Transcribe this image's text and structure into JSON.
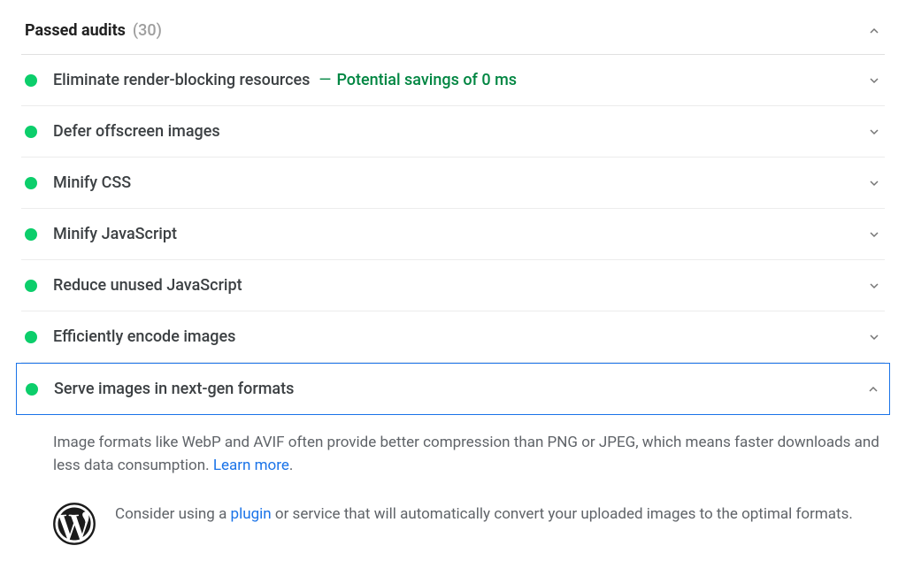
{
  "section": {
    "title": "Passed audits",
    "count": "(30)"
  },
  "audits": [
    {
      "title": "Eliminate render-blocking resources",
      "savings": "Potential savings of 0 ms",
      "expanded": false
    },
    {
      "title": "Defer offscreen images",
      "savings": null,
      "expanded": false
    },
    {
      "title": "Minify CSS",
      "savings": null,
      "expanded": false
    },
    {
      "title": "Minify JavaScript",
      "savings": null,
      "expanded": false
    },
    {
      "title": "Reduce unused JavaScript",
      "savings": null,
      "expanded": false
    },
    {
      "title": "Efficiently encode images",
      "savings": null,
      "expanded": false
    },
    {
      "title": "Serve images in next-gen formats",
      "savings": null,
      "expanded": true
    }
  ],
  "detail": {
    "desc_before": "Image formats like WebP and AVIF often provide better compression than PNG or JPEG, which means faster downloads and less data consumption. ",
    "learn_more": "Learn more",
    "desc_after": ".",
    "stackpack_before": "Consider using a ",
    "plugin_link": "plugin",
    "stackpack_after": " or service that will automatically convert your uploaded images to the optimal formats."
  },
  "savings_separator": "—"
}
